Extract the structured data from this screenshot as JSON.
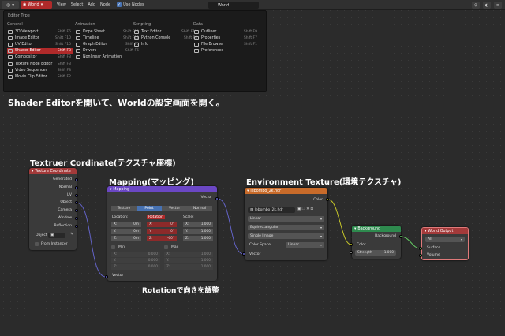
{
  "header": {
    "editor_icon": "globe-icon",
    "world_label": "World",
    "menus": [
      "View",
      "Select",
      "Add",
      "Node"
    ],
    "use_nodes_label": "Use Nodes",
    "world_field": "World"
  },
  "dropdown": {
    "title": "Editor Type",
    "columns": [
      {
        "heading": "General",
        "items": [
          {
            "label": "3D Viewport",
            "shortcut": "Shift F5"
          },
          {
            "label": "Image Editor",
            "shortcut": "Shift F10"
          },
          {
            "label": "UV Editor",
            "shortcut": "Shift F10"
          },
          {
            "label": "Shader Editor",
            "shortcut": "Shift F3",
            "active": true
          },
          {
            "label": "Compositor",
            "shortcut": "Shift F3"
          },
          {
            "label": "Texture Node Editor",
            "shortcut": "Shift F3"
          },
          {
            "label": "Video Sequencer",
            "shortcut": "Shift F8"
          },
          {
            "label": "Movie Clip Editor",
            "shortcut": "Shift F2"
          }
        ]
      },
      {
        "heading": "Animation",
        "items": [
          {
            "label": "Dope Sheet",
            "shortcut": "Shift F12"
          },
          {
            "label": "Timeline",
            "shortcut": "Shift F12"
          },
          {
            "label": "Graph Editor",
            "shortcut": "Shift F6"
          },
          {
            "label": "Drivers",
            "shortcut": "Shift F6"
          },
          {
            "label": "Nonlinear Animation",
            "shortcut": ""
          }
        ]
      },
      {
        "heading": "Scripting",
        "items": [
          {
            "label": "Text Editor",
            "shortcut": "Shift F11"
          },
          {
            "label": "Python Console",
            "shortcut": "Shift F4"
          },
          {
            "label": "Info",
            "shortcut": ""
          }
        ]
      },
      {
        "heading": "Data",
        "items": [
          {
            "label": "Outliner",
            "shortcut": "Shift F9"
          },
          {
            "label": "Properties",
            "shortcut": "Shift F7"
          },
          {
            "label": "File Browser",
            "shortcut": "Shift F1"
          },
          {
            "label": "Preferences",
            "shortcut": ""
          }
        ]
      }
    ]
  },
  "captions": {
    "top": "Shader Editorを開いて、Worldの設定画面を開く。",
    "texcoord": "Textruer Cordinate(テクスチャ座標)",
    "mapping": "Mapping(マッピング)",
    "envtex": "Environment Texture(環境テクスチャ)",
    "rotation": "Rotationで向きを調整"
  },
  "nodes": {
    "texcoord": {
      "title": "Texture Coordinate",
      "outputs": [
        "Generated",
        "Normal",
        "UV",
        "Object",
        "Camera",
        "Window",
        "Reflection"
      ],
      "object_label": "Object",
      "from_instancer": "From Instancer"
    },
    "mapping": {
      "title": "Mapping",
      "output": "Vector",
      "tabs": [
        "Texture",
        "Point",
        "Vector",
        "Normal"
      ],
      "location_label": "Location:",
      "rotation_label": "Rotation",
      "scale_label": "Scale:",
      "location": [
        {
          "axis": "X:",
          "val": "0m"
        },
        {
          "axis": "Y:",
          "val": "0m"
        },
        {
          "axis": "Z:",
          "val": "0m"
        }
      ],
      "rotation": [
        {
          "axis": "X:",
          "val": "0°"
        },
        {
          "axis": "Y:",
          "val": "0°"
        },
        {
          "axis": "Z:",
          "val": "-60°"
        }
      ],
      "scale": [
        {
          "axis": "X:",
          "val": "1.000"
        },
        {
          "axis": "Y:",
          "val": "1.000"
        },
        {
          "axis": "Z:",
          "val": "1.000"
        }
      ],
      "min_label": "Min",
      "max_label": "Max",
      "min": [
        {
          "axis": "X:",
          "val": "0.000"
        },
        {
          "axis": "Y:",
          "val": "0.000"
        },
        {
          "axis": "Z:",
          "val": "0.000"
        }
      ],
      "max": [
        {
          "axis": "X:",
          "val": "1.000"
        },
        {
          "axis": "Y:",
          "val": "1.000"
        },
        {
          "axis": "Z:",
          "val": "1.000"
        }
      ],
      "input": "Vector"
    },
    "envtex": {
      "title": "lebombo_2k.hdr",
      "output": "Color",
      "image_name": "lebombo_2k.hdr",
      "interpolation": "Linear",
      "projection": "Equirectangular",
      "source": "Single Image",
      "colorspace_label": "Color Space",
      "colorspace": "Linear",
      "input": "Vector"
    },
    "background": {
      "title": "Background",
      "output": "Background",
      "color_label": "Color",
      "strength_label": "Strength",
      "strength": "1.000"
    },
    "worldout": {
      "title": "World Output",
      "target": "All",
      "surface": "Surface",
      "volume": "Volume"
    }
  },
  "colors": {
    "input_header": "#a33a3a",
    "vector_header": "#6b47c4",
    "texture_header": "#c86b2a",
    "shader_header": "#2e8a4e",
    "output_header": "#a33a3a",
    "accent": "#4772b3"
  }
}
